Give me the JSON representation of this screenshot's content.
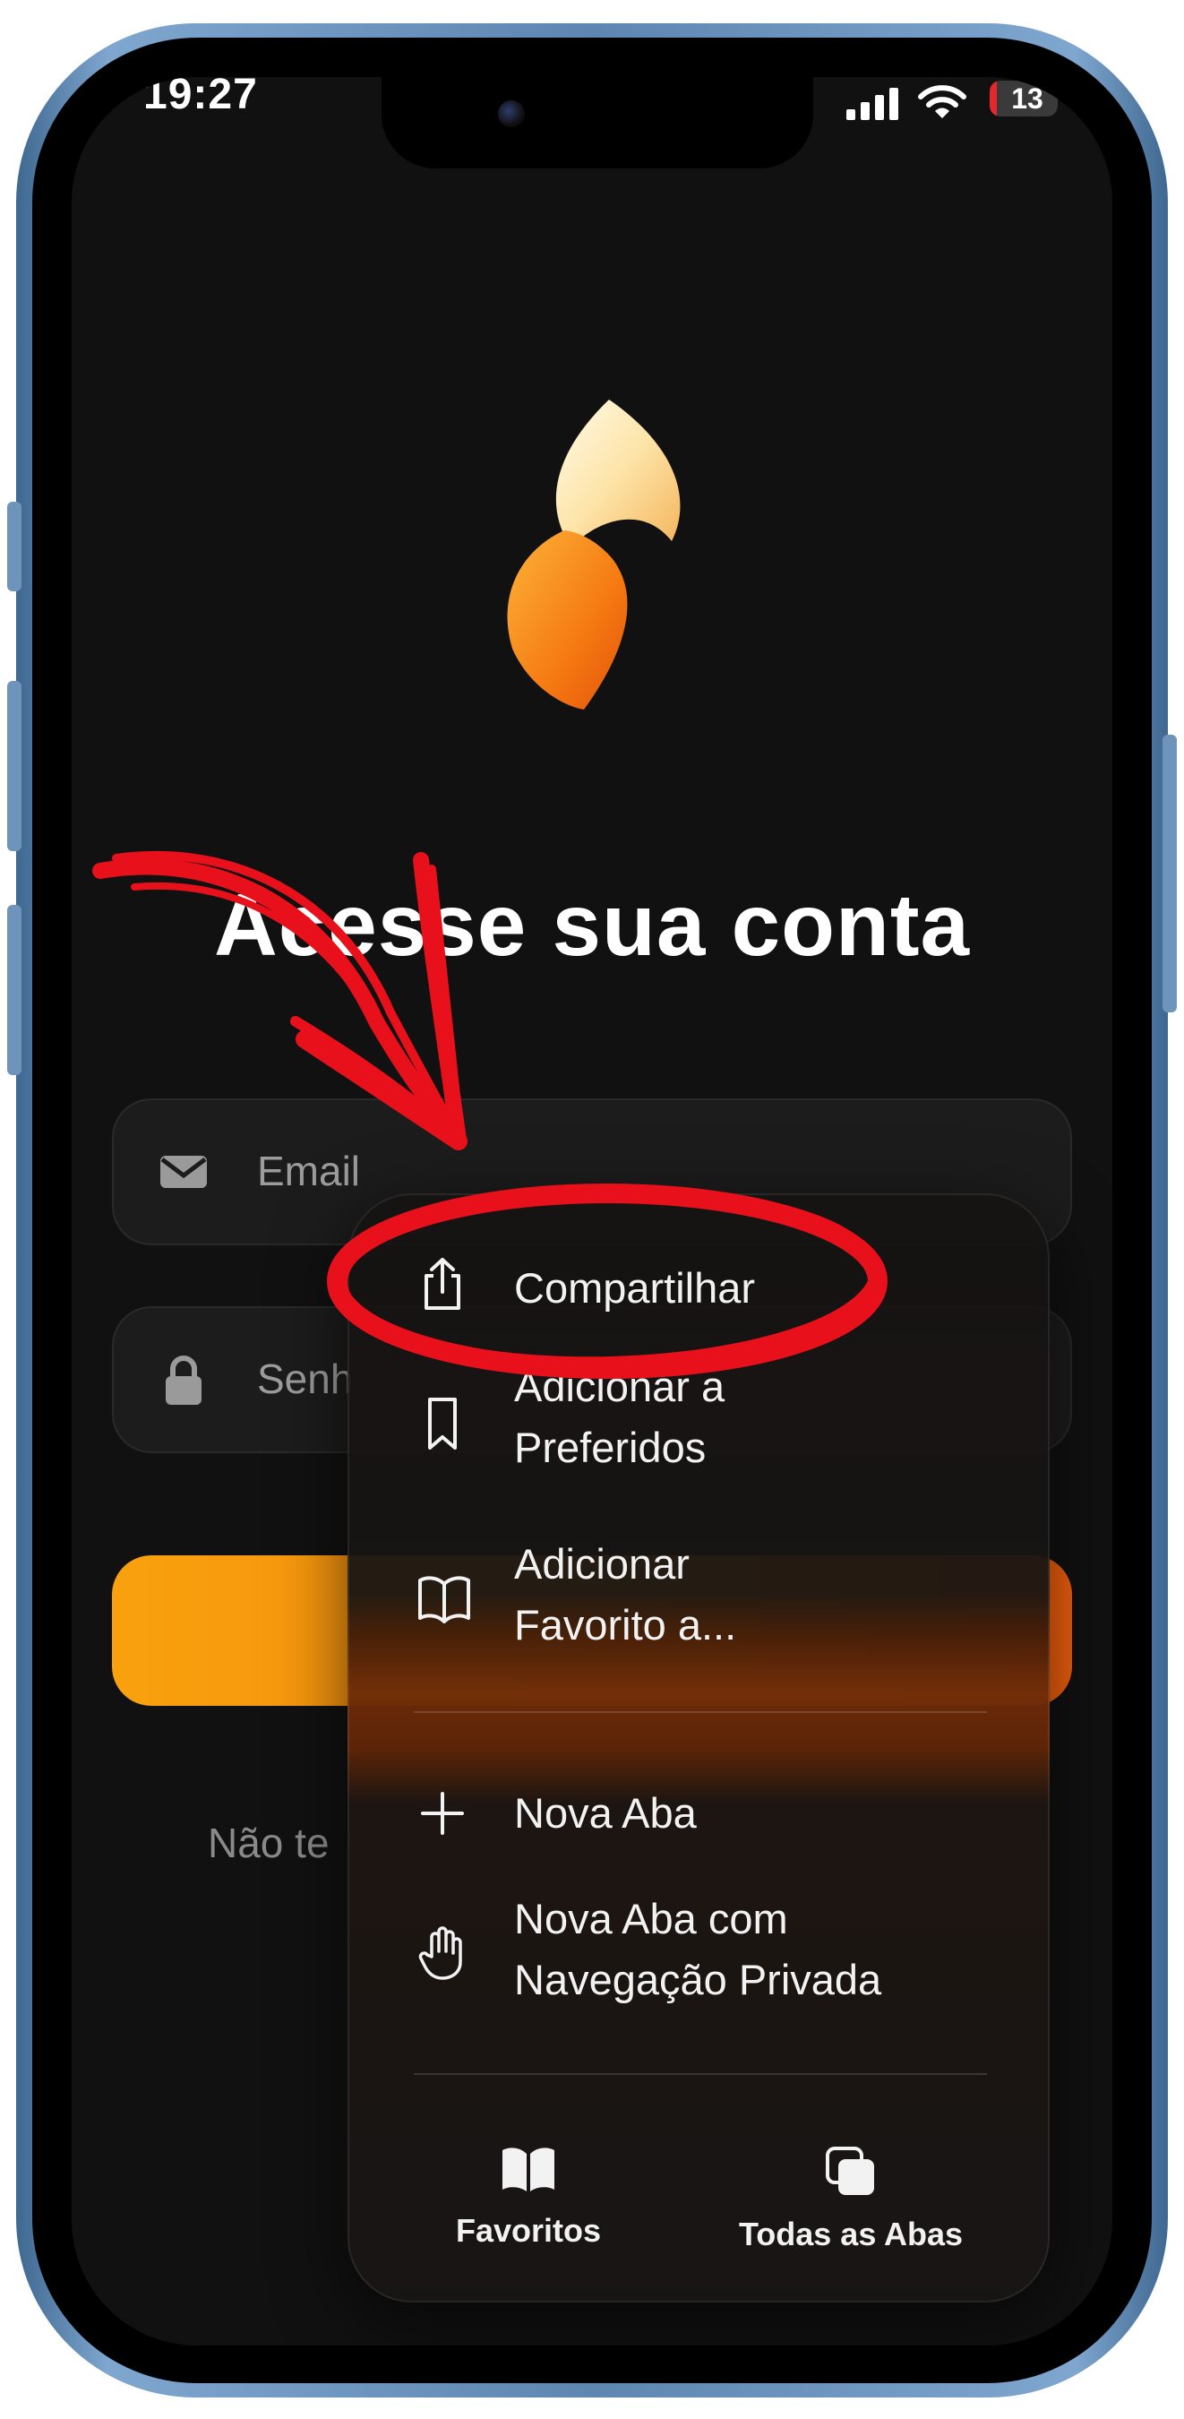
{
  "status_bar": {
    "time": "19:27",
    "battery": "13",
    "battery_color": "#e5262a"
  },
  "page": {
    "headline": "Acesse sua conta",
    "email_placeholder": "Email",
    "password_placeholder": "Senh",
    "signup_text": "Não te",
    "accent_color": "#f7870f",
    "icons": [
      "envelope-icon",
      "lock-icon",
      "flame-logo"
    ]
  },
  "context_menu": {
    "share": "Compartilhar",
    "add_to_preferred_1": "Adicionar a",
    "add_to_preferred_2": "Preferidos",
    "add_bookmark_1": "Adicionar",
    "add_bookmark_2": "Favorito a...",
    "new_tab": "Nova Aba",
    "private_tab_1": "Nova Aba com",
    "private_tab_2": "Navegação Privada",
    "bookmarks": "Favoritos",
    "all_tabs": "Todas as Abas",
    "icons": [
      "share-icon",
      "bookmark-icon",
      "book-open-icon",
      "plus-icon",
      "hand-icon",
      "book-icon",
      "tabs-icon"
    ]
  },
  "annotation": {
    "color": "#e8101a",
    "shapes": [
      "arrow-annotation",
      "circle-annotation"
    ]
  }
}
